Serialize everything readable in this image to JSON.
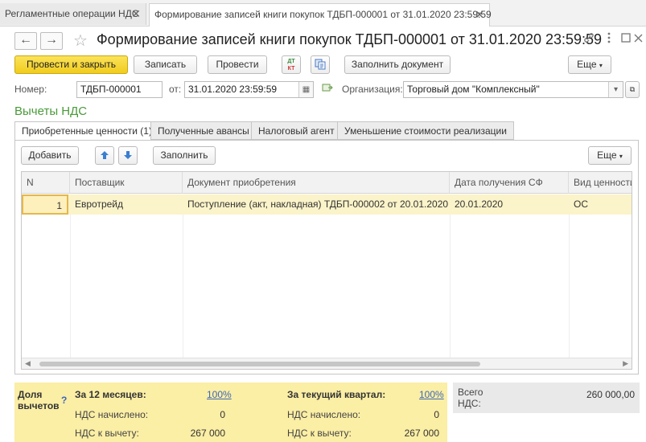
{
  "tabs": [
    {
      "label": "Регламентные операции НДС",
      "close": "✕"
    },
    {
      "label": "Формирование записей книги покупок ТДБП-000001 от 31.01.2020 23:59:59",
      "close": "✕"
    }
  ],
  "header": {
    "title": "Формирование записей книги покупок ТДБП-000001 от 31.01.2020 23:59:59",
    "back": "←",
    "forward": "→",
    "star": "☆"
  },
  "toolbar": {
    "post_close": "Провести и закрыть",
    "save": "Записать",
    "post": "Провести",
    "dtkt_top": "ДТ",
    "dtkt_bottom": "КТ",
    "fill_doc": "Заполнить документ",
    "more": "Еще"
  },
  "fields": {
    "number_label": "Номер:",
    "number_value": "ТДБП-000001",
    "date_label": "от:",
    "date_value": "31.01.2020 23:59:59",
    "org_label": "Организация:",
    "org_value": "Торговый дом \"Комплексный\""
  },
  "section_title": "Вычеты НДС",
  "inner_tabs": [
    "Приобретенные ценности (1)",
    "Полученные авансы",
    "Налоговый агент",
    "Уменьшение стоимости реализации"
  ],
  "table_toolbar": {
    "add": "Добавить",
    "up": "🡅",
    "down": "🡇",
    "fill": "Заполнить",
    "more": "Еще"
  },
  "table": {
    "columns": [
      "N",
      "Поставщик",
      "Документ приобретения",
      "Дата получения СФ",
      "Вид ценности"
    ],
    "rows": [
      [
        "1",
        "Евротрейд",
        "Поступление (акт, накладная) ТДБП-000002 от 20.01.2020 ...",
        "20.01.2020",
        "ОС"
      ]
    ]
  },
  "summary": {
    "share_label_1": "Доля",
    "share_label_2": "вычетов",
    "help": "?",
    "months_title": "За 12 месяцев:",
    "months_pct": "100%",
    "months_charged_label": "НДС начислено:",
    "months_charged": "0",
    "months_deduct_label": "НДС к вычету:",
    "months_deduct": "267 000",
    "quarter_title": "За текущий квартал:",
    "quarter_pct": "100%",
    "quarter_charged_label": "НДС начислено:",
    "quarter_charged": "0",
    "quarter_deduct_label": "НДС к вычету:",
    "quarter_deduct": "267 000",
    "total_label_1": "Всего",
    "total_label_2": "НДС:",
    "total_value": "260 000,00"
  }
}
